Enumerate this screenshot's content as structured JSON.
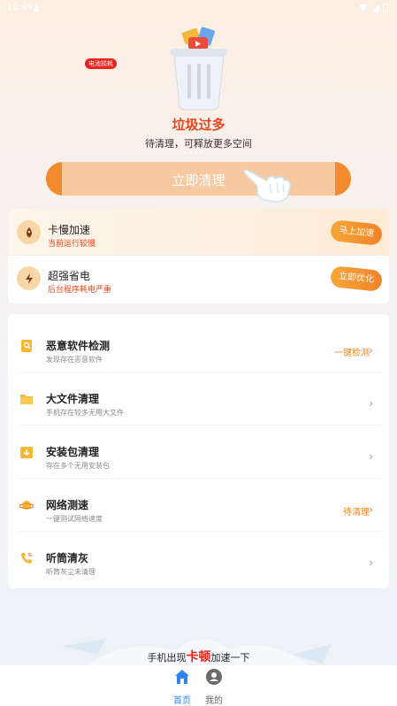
{
  "status_bar": {
    "time": "10:49"
  },
  "hero": {
    "title": "垃圾过多",
    "subtitle": "待清理，可释放更多空间",
    "clean_button": "立即清理"
  },
  "quick_actions": [
    {
      "title": "卡慢加速",
      "subtitle": "当前运行较慢",
      "button": "马上加速",
      "icon": "rocket-icon"
    },
    {
      "title": "超强省电",
      "subtitle": "后台程序耗电严重",
      "badge": "电池损耗",
      "button": "立即优化",
      "icon": "lightning-icon"
    }
  ],
  "tools": [
    {
      "title": "恶意软件检测",
      "subtitle": "发现存在恶意软件",
      "action": "一键检测",
      "icon": "malware-scan-icon"
    },
    {
      "title": "大文件清理",
      "subtitle": "手机存在较多无用大文件",
      "action": "",
      "icon": "folder-icon"
    },
    {
      "title": "安装包清理",
      "subtitle": "存在多个无用安装包",
      "action": "",
      "icon": "package-download-icon"
    },
    {
      "title": "网络测速",
      "subtitle": "一键测试网络速度",
      "action": "待清理",
      "icon": "planet-icon"
    },
    {
      "title": "听筒清灰",
      "subtitle": "听筒灰尘未清理",
      "action": "",
      "icon": "phone-icon"
    }
  ],
  "promo": {
    "prefix": "手机出现",
    "highlight": "卡顿",
    "suffix": "加速一下"
  },
  "tabs": [
    {
      "label": "首页",
      "active": true,
      "icon": "home-icon"
    },
    {
      "label": "我的",
      "active": false,
      "icon": "profile-icon"
    }
  ],
  "colors": {
    "accent": "#f0842a",
    "alert": "#e8451e",
    "tab_active": "#2e86f5"
  }
}
